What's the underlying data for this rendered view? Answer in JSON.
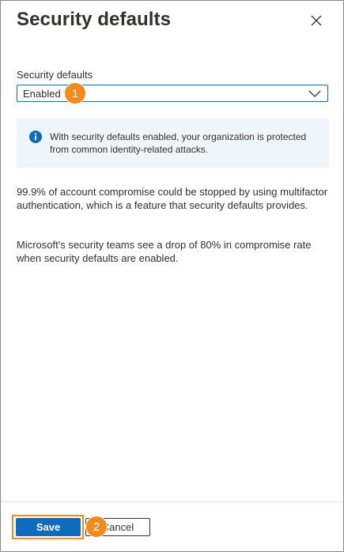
{
  "panel": {
    "title": "Security defaults",
    "close_icon": "close-icon"
  },
  "field": {
    "label": "Security defaults",
    "selected_value": "Enabled",
    "dropdown_icon": "chevron-down-icon"
  },
  "info": {
    "icon": "info-icon",
    "text": "With security defaults enabled, your organization is protected from common identity-related attacks."
  },
  "body": {
    "paragraph_1": "99.9% of account compromise could be stopped by using multifactor authentication, which is a feature that security defaults provides.",
    "paragraph_2": "Microsoft's security teams see a drop of 80% in compromise rate when security defaults are enabled."
  },
  "callouts": {
    "step_1": "1",
    "step_2": "2"
  },
  "footer": {
    "save_label": "Save",
    "cancel_label": "Cancel"
  },
  "colors": {
    "accent": "#0f6cbd",
    "callout": "#f38b1c",
    "info_background": "#eff5fb"
  }
}
